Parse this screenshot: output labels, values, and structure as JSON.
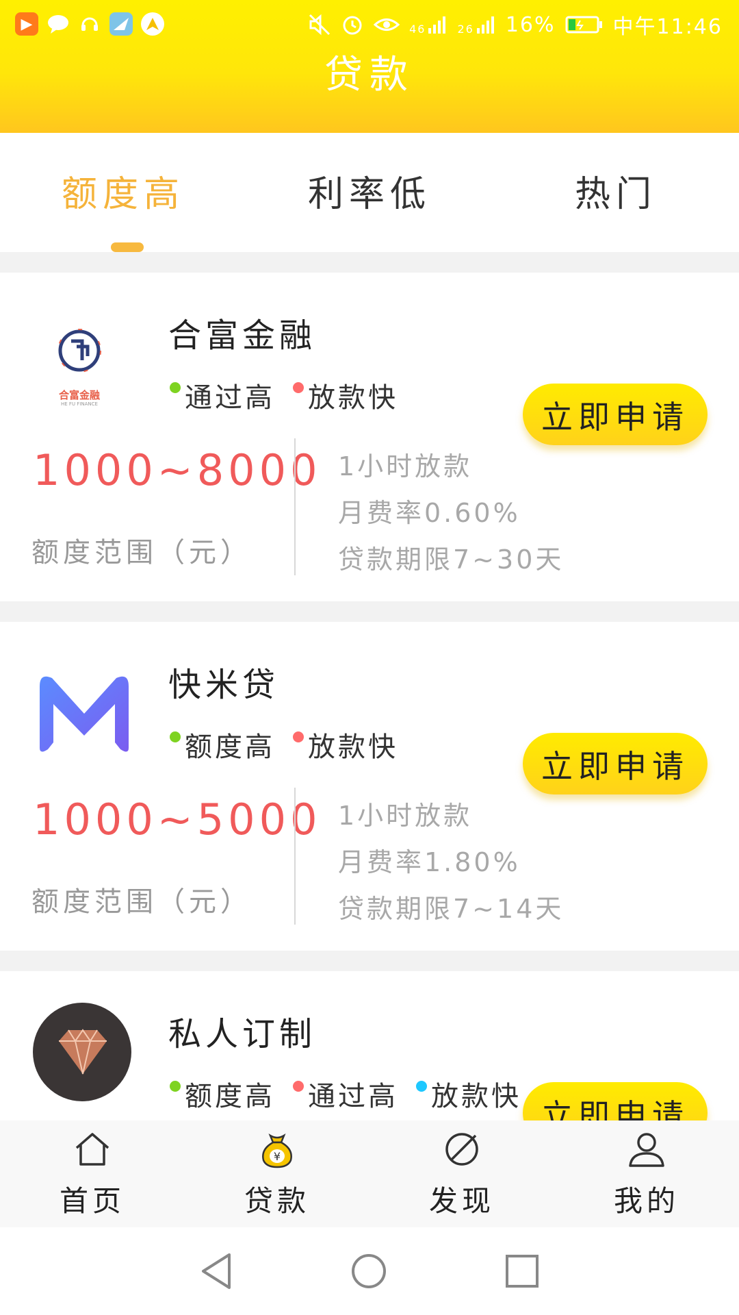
{
  "status": {
    "signal_4g": "46",
    "signal_2g": "26",
    "battery": "16%",
    "time": "中午11:46"
  },
  "header": {
    "title": "贷款"
  },
  "tabs": [
    {
      "label": "额度高",
      "active": true
    },
    {
      "label": "利率低",
      "active": false
    },
    {
      "label": "热门",
      "active": false
    }
  ],
  "cards": [
    {
      "name": "合富金融",
      "logo_text": "合富金融",
      "logo_sub": "HE FU FINANCE",
      "tags": [
        {
          "label": "通过高",
          "color": "#7ed321"
        },
        {
          "label": "放款快",
          "color": "#ff6b6b"
        }
      ],
      "apply_label": "立即申请",
      "amount": "1000~8000",
      "amount_label": "额度范围（元）",
      "details": [
        "1小时放款",
        "月费率0.60%",
        "贷款期限7~30天"
      ]
    },
    {
      "name": "快米贷",
      "tags": [
        {
          "label": "额度高",
          "color": "#7ed321"
        },
        {
          "label": "放款快",
          "color": "#ff6b6b"
        }
      ],
      "apply_label": "立即申请",
      "amount": "1000~5000",
      "amount_label": "额度范围（元）",
      "details": [
        "1小时放款",
        "月费率1.80%",
        "贷款期限7~14天"
      ]
    },
    {
      "name": "私人订制",
      "tags": [
        {
          "label": "额度高",
          "color": "#7ed321"
        },
        {
          "label": "通过高",
          "color": "#ff6b6b"
        },
        {
          "label": "放款快",
          "color": "#1ec8ff"
        }
      ],
      "apply_label": "立即申请"
    }
  ],
  "bottom_nav": [
    {
      "label": "首页",
      "icon": "home-icon"
    },
    {
      "label": "贷款",
      "icon": "money-bag-icon"
    },
    {
      "label": "发现",
      "icon": "compass-icon"
    },
    {
      "label": "我的",
      "icon": "user-icon"
    }
  ],
  "colors": {
    "accent": "#f5b33a",
    "amount": "#f05a5a",
    "button": "#ffe000"
  }
}
